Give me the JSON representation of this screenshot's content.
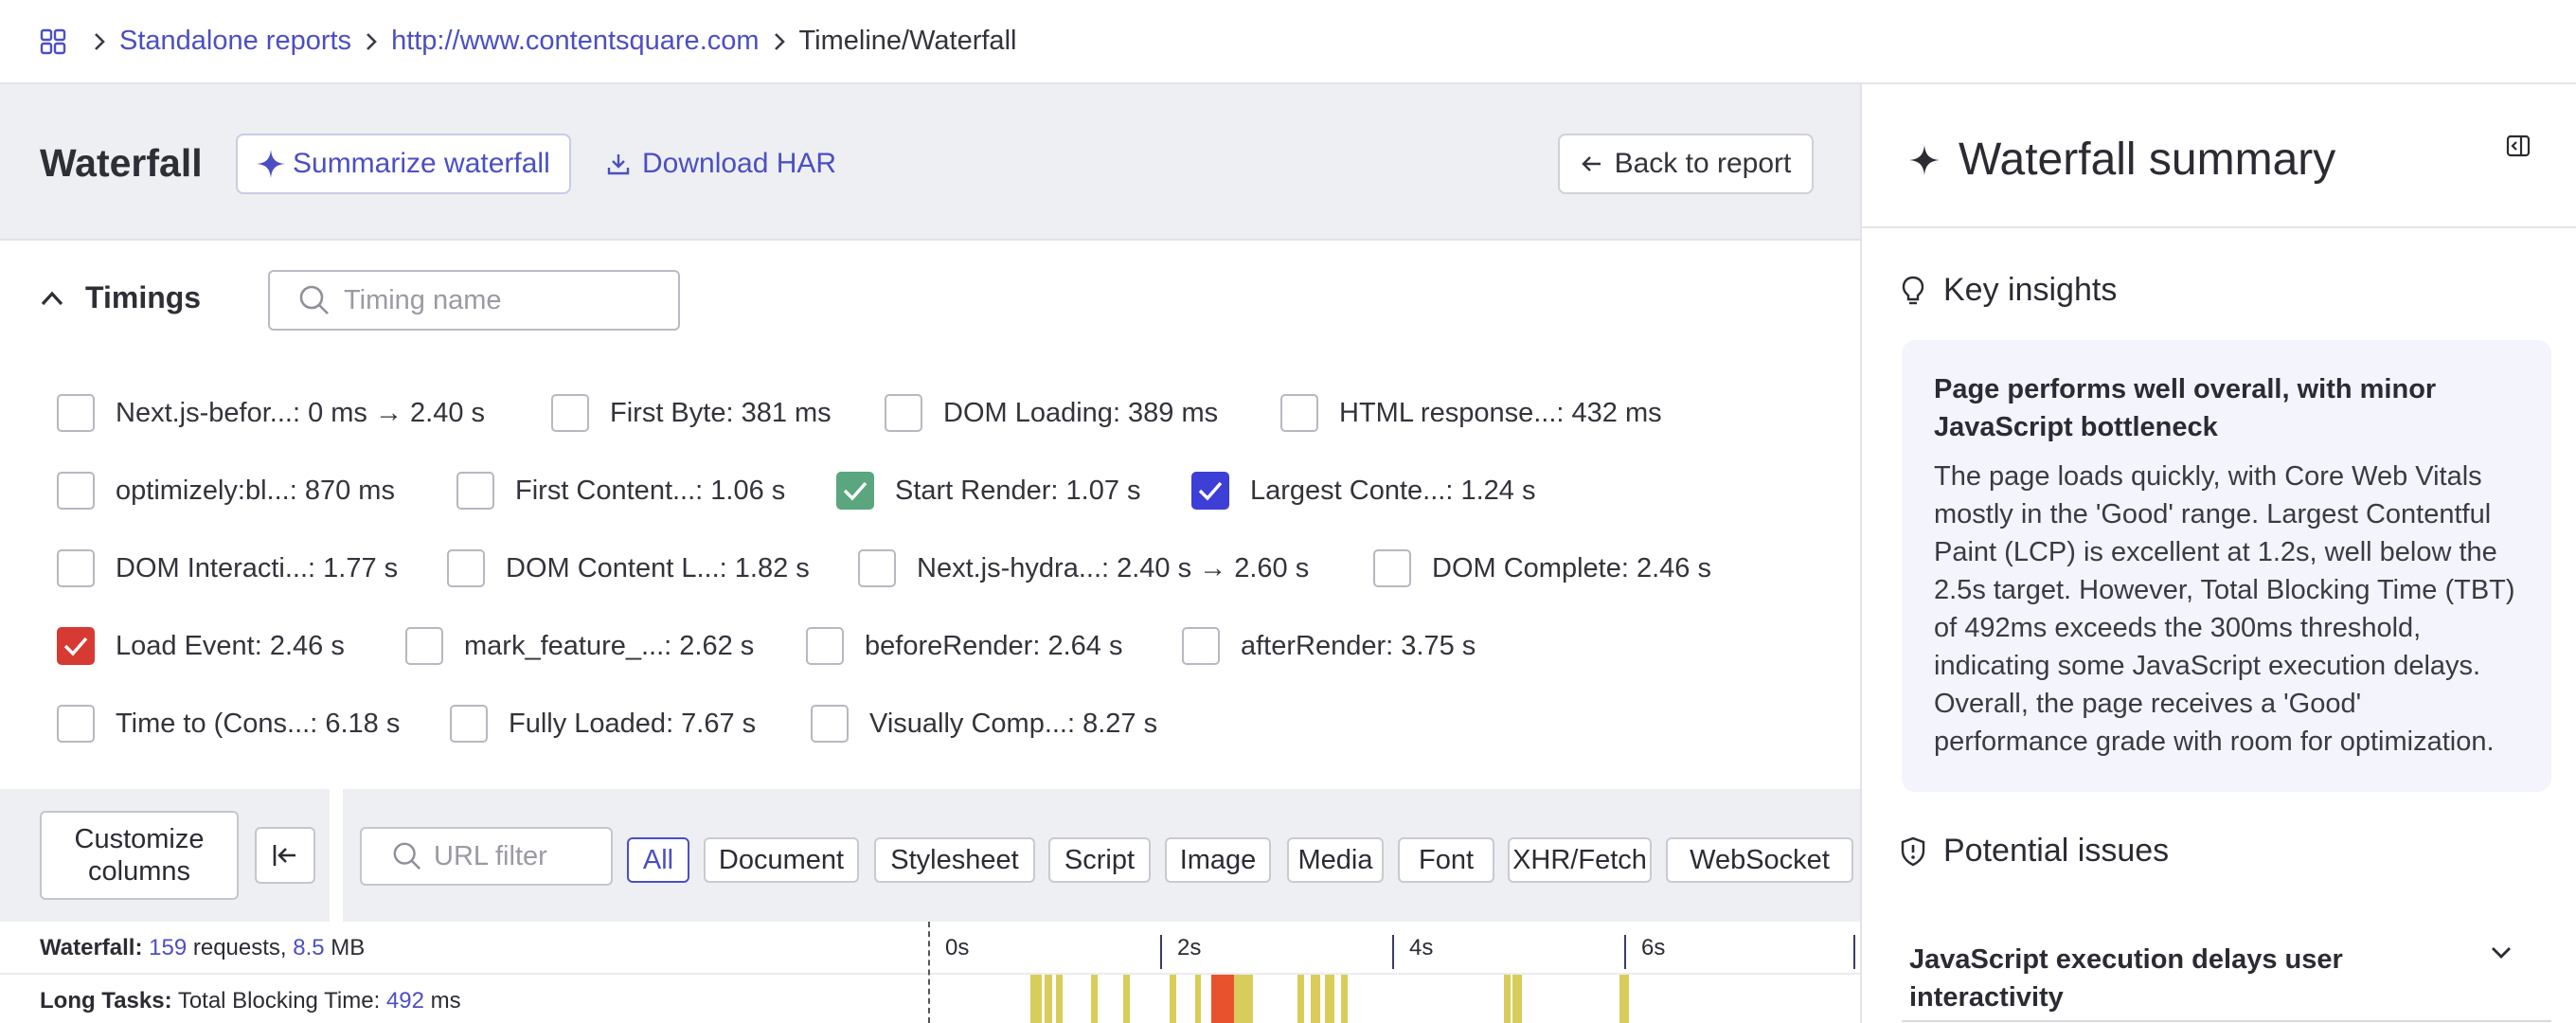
{
  "breadcrumb": {
    "items": [
      {
        "label": "Standalone reports",
        "link": true
      },
      {
        "label": "http://www.contentsquare.com",
        "link": true
      },
      {
        "label": "Timeline/Waterfall",
        "link": false
      }
    ]
  },
  "header": {
    "title": "Waterfall",
    "summarize_label": "Summarize waterfall",
    "download_label": "Download HAR",
    "back_label": "Back to report"
  },
  "timings": {
    "title": "Timings",
    "search_placeholder": "Timing name",
    "rows": [
      [
        {
          "name": "Next.js-befor...",
          "value": ": 0 ms → 2.40 s",
          "checked": false,
          "color": null
        },
        {
          "name": "First Byte",
          "value": ": 381 ms",
          "checked": false,
          "color": null
        },
        {
          "name": "DOM Loading",
          "value": ": 389 ms",
          "checked": false,
          "color": null
        },
        {
          "name": "HTML response...",
          "value": ": 432 ms",
          "checked": false,
          "color": null
        }
      ],
      [
        {
          "name": "optimizely:bl...",
          "value": ": 870 ms",
          "checked": false,
          "color": null
        },
        {
          "name": "First Content...",
          "value": ": 1.06 s",
          "checked": false,
          "color": null
        },
        {
          "name": "Start Render",
          "value": ": 1.07 s",
          "checked": true,
          "color": "green"
        },
        {
          "name": "Largest Conte...",
          "value": ": 1.24 s",
          "checked": true,
          "color": "blue"
        }
      ],
      [
        {
          "name": "DOM Interacti...",
          "value": ": 1.77 s",
          "checked": false,
          "color": null
        },
        {
          "name": "DOM Content L...",
          "value": ": 1.82 s",
          "checked": false,
          "color": null
        },
        {
          "name": "Next.js-hydra...",
          "value": ": 2.40 s → 2.60 s",
          "checked": false,
          "color": null
        },
        {
          "name": "DOM Complete",
          "value": ": 2.46 s",
          "checked": false,
          "color": null
        }
      ],
      [
        {
          "name": "Load Event",
          "value": ": 2.46 s",
          "checked": true,
          "color": "red"
        },
        {
          "name": "mark_feature_...",
          "value": ": 2.62 s",
          "checked": false,
          "color": null
        },
        {
          "name": "beforeRender",
          "value": ": 2.64 s",
          "checked": false,
          "color": null
        },
        {
          "name": "afterRender",
          "value": ": 3.75 s",
          "checked": false,
          "color": null
        }
      ],
      [
        {
          "name": "Time to (Cons...",
          "value": ": 6.18 s",
          "checked": false,
          "color": null
        },
        {
          "name": "Fully Loaded",
          "value": ": 7.67 s",
          "checked": false,
          "color": null
        },
        {
          "name": "Visually Comp...",
          "value": ": 8.27 s",
          "checked": false,
          "color": null
        }
      ]
    ]
  },
  "toolbar": {
    "customize_label": "Customize\ncolumns",
    "url_placeholder": "URL filter",
    "filters": [
      "All",
      "Document",
      "Stylesheet",
      "Script",
      "Image",
      "Media",
      "Font",
      "XHR/Fetch",
      "WebSocket"
    ],
    "active_filter": "All"
  },
  "waterfall": {
    "label": "Waterfall:",
    "requests": "159",
    "requests_suffix": " requests, ",
    "size": "8.5",
    "size_unit": " MB",
    "ticks": [
      "0s",
      "2s",
      "4s",
      "6s"
    ],
    "long_tasks_label": "Long Tasks:",
    "tbt_label": " Total Blocking Time: ",
    "tbt_value": "492",
    "tbt_unit": " ms"
  },
  "long_tasks": [
    {
      "start": 0.88,
      "end": 0.98,
      "kind": "normal"
    },
    {
      "start": 1.0,
      "end": 1.07,
      "kind": "normal"
    },
    {
      "start": 1.1,
      "end": 1.16,
      "kind": "normal"
    },
    {
      "start": 1.4,
      "end": 1.46,
      "kind": "normal"
    },
    {
      "start": 1.68,
      "end": 1.74,
      "kind": "normal"
    },
    {
      "start": 2.08,
      "end": 2.14,
      "kind": "normal"
    },
    {
      "start": 2.3,
      "end": 2.34,
      "kind": "normal"
    },
    {
      "start": 2.44,
      "end": 2.64,
      "kind": "high"
    },
    {
      "start": 2.64,
      "end": 2.8,
      "kind": "normal"
    },
    {
      "start": 3.18,
      "end": 3.24,
      "kind": "normal"
    },
    {
      "start": 3.3,
      "end": 3.38,
      "kind": "normal"
    },
    {
      "start": 3.42,
      "end": 3.5,
      "kind": "normal"
    },
    {
      "start": 3.56,
      "end": 3.62,
      "kind": "normal"
    },
    {
      "start": 4.96,
      "end": 5.02,
      "kind": "normal"
    },
    {
      "start": 5.04,
      "end": 5.12,
      "kind": "normal"
    },
    {
      "start": 5.96,
      "end": 6.04,
      "kind": "normal"
    }
  ],
  "summary": {
    "title": "Waterfall summary",
    "key_insights_label": "Key insights",
    "insight_title": "Page performs well overall, with minor JavaScript bottleneck",
    "insight_body": "The page loads quickly, with Core Web Vitals mostly in the 'Good' range. Largest Contentful Paint (LCP) is excellent at 1.2s, well below the 2.5s target. However, Total Blocking Time (TBT) of 492ms exceeds the 300ms threshold, indicating some JavaScript execution delays. Overall, the page receives a 'Good' performance grade with room for optimization.",
    "potential_issues_label": "Potential issues",
    "issue_1": "JavaScript execution delays user interactivity"
  },
  "colors": {
    "accent": "#4b4fc4",
    "start_render": "#5aa67e",
    "lcp": "#3d3fd6",
    "load_event": "#d63a32",
    "long_task": "#d8cd5a",
    "long_task_high": "#e8522c"
  }
}
